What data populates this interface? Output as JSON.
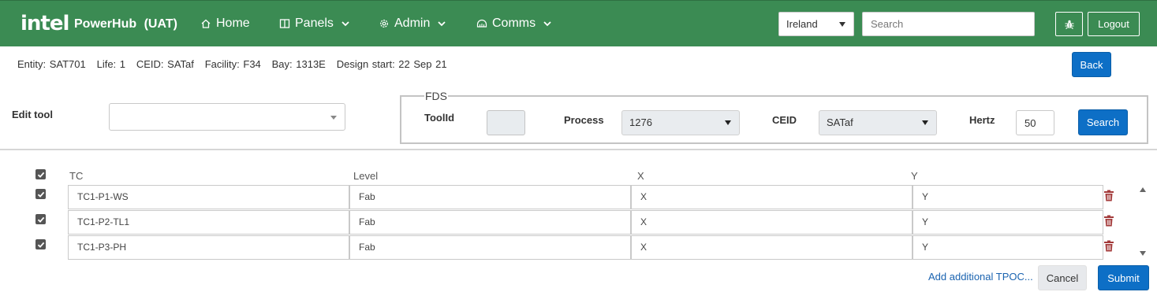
{
  "nav": {
    "logo": "intel",
    "app_name": "PowerHub",
    "environment": "(UAT)",
    "items": [
      {
        "label": "Home",
        "icon": "home-icon"
      },
      {
        "label": "Panels",
        "icon": "panels-icon"
      },
      {
        "label": "Admin",
        "icon": "gear-icon"
      },
      {
        "label": "Comms",
        "icon": "comms-icon"
      }
    ],
    "region": "Ireland",
    "search_placeholder": "Search",
    "bug_icon": "bug-icon",
    "logout_label": "Logout"
  },
  "entity_info": {
    "entity": "Entity: SAT701",
    "life": "Life: 1",
    "ceid": "CEID: SATaf",
    "facility": "Facility: F34",
    "bay": "Bay: 1313E",
    "design_start": "Design start: 22 Sep 21"
  },
  "back_label": "Back",
  "edit_tool": {
    "label": "Edit tool",
    "value": ""
  },
  "fds": {
    "legend": "FDS",
    "toolid_label": "ToolId",
    "toolid_value": "",
    "process_label": "Process",
    "process_value": "1276",
    "ceid_label": "CEID",
    "ceid_value": "SATaf",
    "hertz_label": "Hertz",
    "hertz_value": "50",
    "search_label": "Search"
  },
  "table": {
    "headers": {
      "tc": "TC",
      "level": "Level",
      "x": "X",
      "y": "Y"
    },
    "select_all_checked": true,
    "rows": [
      {
        "checked": true,
        "tc": "TC1-P1-WS",
        "level": "Fab",
        "x": "X",
        "y": "Y"
      },
      {
        "checked": true,
        "tc": "TC1-P2-TL1",
        "level": "Fab",
        "x": "X",
        "y": "Y"
      },
      {
        "checked": true,
        "tc": "TC1-P3-PH",
        "level": "Fab",
        "x": "X",
        "y": "Y"
      }
    ]
  },
  "actions": {
    "add_link": "Add additional TPOC...",
    "cancel": "Cancel",
    "submit": "Submit"
  },
  "colors": {
    "nav_bg": "#3b8b53",
    "primary": "#0d6fc6",
    "trash": "#a33a3a",
    "link": "#1a63b0"
  }
}
